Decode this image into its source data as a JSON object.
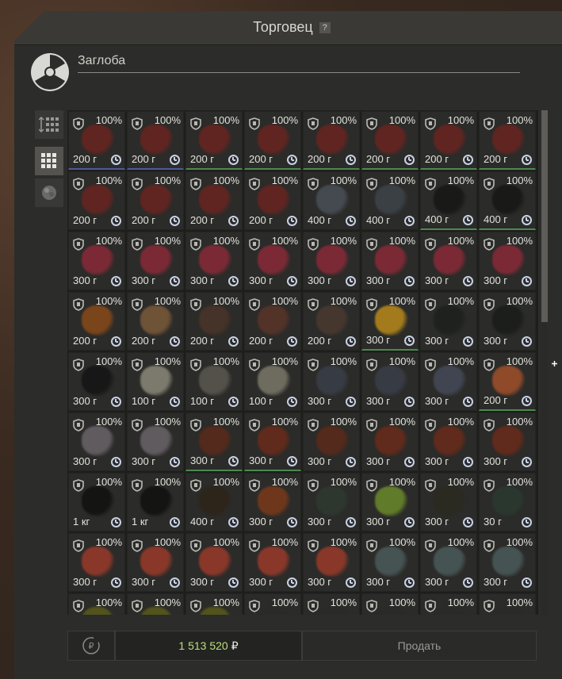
{
  "window": {
    "title": "Торговец",
    "help_label": "?"
  },
  "trader": {
    "name": "Заглоба"
  },
  "sidebar": {
    "items": [
      {
        "icon": "sort-icon",
        "active": false
      },
      {
        "icon": "grid-view-icon",
        "active": true
      },
      {
        "icon": "artifact-category-icon",
        "active": false
      }
    ]
  },
  "inventory": {
    "rows": [
      [
        {
          "pct": "100%",
          "weight": "200 г",
          "color": "#6a2420",
          "border": "b"
        },
        {
          "pct": "100%",
          "weight": "200 г",
          "color": "#6a2420",
          "border": "b"
        },
        {
          "pct": "100%",
          "weight": "200 г",
          "color": "#6a2420",
          "border": "g"
        },
        {
          "pct": "100%",
          "weight": "200 г",
          "color": "#6a2420",
          "border": "g"
        },
        {
          "pct": "100%",
          "weight": "200 г",
          "color": "#6a2420",
          "border": "g"
        },
        {
          "pct": "100%",
          "weight": "200 г",
          "color": "#6a2420",
          "border": "g"
        },
        {
          "pct": "100%",
          "weight": "200 г",
          "color": "#6a2420",
          "border": "g"
        },
        {
          "pct": "100%",
          "weight": "200 г",
          "color": "#6a2420",
          "border": "g"
        }
      ],
      [
        {
          "pct": "100%",
          "weight": "200 г",
          "color": "#6a2420",
          "border": ""
        },
        {
          "pct": "100%",
          "weight": "200 г",
          "color": "#6a2420",
          "border": ""
        },
        {
          "pct": "100%",
          "weight": "200 г",
          "color": "#6a2420",
          "border": ""
        },
        {
          "pct": "100%",
          "weight": "200 г",
          "color": "#6a2420",
          "border": ""
        },
        {
          "pct": "100%",
          "weight": "400 г",
          "color": "#4a5058",
          "border": ""
        },
        {
          "pct": "100%",
          "weight": "400 г",
          "color": "#3e444a",
          "border": ""
        },
        {
          "pct": "100%",
          "weight": "400 г",
          "color": "#161616",
          "border": "g"
        },
        {
          "pct": "100%",
          "weight": "400 г",
          "color": "#161616",
          "border": "g"
        }
      ],
      [
        {
          "pct": "100%",
          "weight": "300 г",
          "color": "#8a2a38",
          "border": ""
        },
        {
          "pct": "100%",
          "weight": "300 г",
          "color": "#8a2a38",
          "border": ""
        },
        {
          "pct": "100%",
          "weight": "300 г",
          "color": "#8a2a38",
          "border": ""
        },
        {
          "pct": "100%",
          "weight": "300 г",
          "color": "#8a2a38",
          "border": ""
        },
        {
          "pct": "100%",
          "weight": "300 г",
          "color": "#8a2a38",
          "border": ""
        },
        {
          "pct": "100%",
          "weight": "300 г",
          "color": "#8a2a38",
          "border": ""
        },
        {
          "pct": "100%",
          "weight": "300 г",
          "color": "#8a2a38",
          "border": ""
        },
        {
          "pct": "100%",
          "weight": "300 г",
          "color": "#8a2a38",
          "border": ""
        }
      ],
      [
        {
          "pct": "100%",
          "weight": "200 г",
          "color": "#8a4a1a",
          "border": ""
        },
        {
          "pct": "100%",
          "weight": "200 г",
          "color": "#7a5a3a",
          "border": ""
        },
        {
          "pct": "100%",
          "weight": "200 г",
          "color": "#4a3428",
          "border": ""
        },
        {
          "pct": "100%",
          "weight": "200 г",
          "color": "#5a3428",
          "border": ""
        },
        {
          "pct": "100%",
          "weight": "200 г",
          "color": "#4a3a30",
          "border": ""
        },
        {
          "pct": "100%",
          "weight": "300 г",
          "color": "#b88a1a",
          "border": "g"
        },
        {
          "pct": "100%",
          "weight": "300 г",
          "color": "#1e201e",
          "border": ""
        },
        {
          "pct": "100%",
          "weight": "300 г",
          "color": "#1a1c1a",
          "border": ""
        }
      ],
      [
        {
          "pct": "100%",
          "weight": "300 г",
          "color": "#141414",
          "border": ""
        },
        {
          "pct": "100%",
          "weight": "100 г",
          "color": "#8a8878",
          "border": ""
        },
        {
          "pct": "100%",
          "weight": "100 г",
          "color": "#5a5850",
          "border": ""
        },
        {
          "pct": "100%",
          "weight": "100 г",
          "color": "#7a7868",
          "border": ""
        },
        {
          "pct": "100%",
          "weight": "300 г",
          "color": "#3a3e48",
          "border": ""
        },
        {
          "pct": "100%",
          "weight": "300 г",
          "color": "#3a3e48",
          "border": ""
        },
        {
          "pct": "100%",
          "weight": "300 г",
          "color": "#454a58",
          "border": ""
        },
        {
          "pct": "100%",
          "weight": "200 г",
          "color": "#a0502a",
          "border": "g"
        }
      ],
      [
        {
          "pct": "100%",
          "weight": "300 г",
          "color": "#6a6468",
          "border": ""
        },
        {
          "pct": "100%",
          "weight": "300 г",
          "color": "#6a6468",
          "border": ""
        },
        {
          "pct": "100%",
          "weight": "300 г",
          "color": "#5a2a1a",
          "border": "g"
        },
        {
          "pct": "100%",
          "weight": "300 г",
          "color": "#6a2a1a",
          "border": "g"
        },
        {
          "pct": "100%",
          "weight": "300 г",
          "color": "#5a2a1a",
          "border": ""
        },
        {
          "pct": "100%",
          "weight": "300 г",
          "color": "#6a2a1a",
          "border": ""
        },
        {
          "pct": "100%",
          "weight": "300 г",
          "color": "#6a2a1a",
          "border": ""
        },
        {
          "pct": "100%",
          "weight": "300 г",
          "color": "#6a2a1a",
          "border": ""
        }
      ],
      [
        {
          "pct": "100%",
          "weight": "1 кг",
          "color": "#101010",
          "border": ""
        },
        {
          "pct": "100%",
          "weight": "1 кг",
          "color": "#101010",
          "border": ""
        },
        {
          "pct": "100%",
          "weight": "400 г",
          "color": "#2e2418",
          "border": ""
        },
        {
          "pct": "100%",
          "weight": "300 г",
          "color": "#7a3a1a",
          "border": ""
        },
        {
          "pct": "100%",
          "weight": "300 г",
          "color": "#2e3a30",
          "border": ""
        },
        {
          "pct": "100%",
          "weight": "300 г",
          "color": "#6a8a2a",
          "border": ""
        },
        {
          "pct": "100%",
          "weight": "300 г",
          "color": "#2a2a20",
          "border": ""
        },
        {
          "pct": "100%",
          "weight": "30 г",
          "color": "#2a3a30",
          "border": ""
        }
      ],
      [
        {
          "pct": "100%",
          "weight": "300 г",
          "color": "#9a3a2a",
          "border": ""
        },
        {
          "pct": "100%",
          "weight": "300 г",
          "color": "#9a3a2a",
          "border": ""
        },
        {
          "pct": "100%",
          "weight": "300 г",
          "color": "#9a3a2a",
          "border": ""
        },
        {
          "pct": "100%",
          "weight": "300 г",
          "color": "#9a3a2a",
          "border": ""
        },
        {
          "pct": "100%",
          "weight": "300 г",
          "color": "#9a3a2a",
          "border": ""
        },
        {
          "pct": "100%",
          "weight": "300 г",
          "color": "#4a5a5a",
          "border": ""
        },
        {
          "pct": "100%",
          "weight": "300 г",
          "color": "#4a5a5a",
          "border": ""
        },
        {
          "pct": "100%",
          "weight": "300 г",
          "color": "#4a5a5a",
          "border": ""
        }
      ],
      [
        {
          "pct": "100%",
          "weight": "",
          "color": "#5a5a1a",
          "border": ""
        },
        {
          "pct": "100%",
          "weight": "",
          "color": "#5a5a1a",
          "border": ""
        },
        {
          "pct": "100%",
          "weight": "",
          "color": "#5a5a1a",
          "border": ""
        },
        {
          "pct": "100%",
          "weight": "",
          "color": "#2a2a2a",
          "border": ""
        },
        {
          "pct": "100%",
          "weight": "",
          "color": "#2a2a2a",
          "border": ""
        },
        {
          "pct": "100%",
          "weight": "",
          "color": "#2a2a2a",
          "border": ""
        },
        {
          "pct": "100%",
          "weight": "",
          "color": "#2a2a2a",
          "border": ""
        },
        {
          "pct": "100%",
          "weight": "",
          "color": "#2a2a2a",
          "border": ""
        }
      ]
    ]
  },
  "scroll": {
    "position_fraction": 0.0,
    "visible_fraction": 0.42
  },
  "footer": {
    "money": "1 513 520",
    "currency": "₽",
    "sell_label": "Продать"
  },
  "colors": {
    "money": "#b8e07a",
    "border_green": "#4c8a4e",
    "border_blue": "#4e5a9a"
  }
}
